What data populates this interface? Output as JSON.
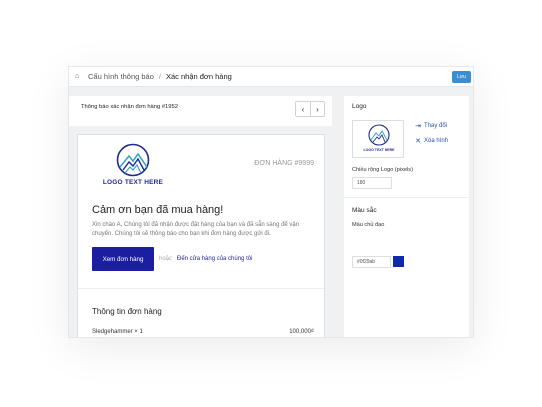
{
  "breadcrumb": {
    "parent": "Cấu hình thông báo",
    "separator": "/",
    "current": "Xác nhận đơn hàng"
  },
  "toolbar": {
    "save_label": "Lưu"
  },
  "preview": {
    "header_title": "Thông báo xác nhận đơn hàng #1952",
    "prev_icon": "chevron-left-icon",
    "next_icon": "chevron-right-icon"
  },
  "email": {
    "logo_text": "LOGO TEXT HERE",
    "order_number": "ĐƠN HÀNG #9999",
    "thanks_title": "Cảm ơn bạn đã mua hàng!",
    "thanks_desc": "Xin chào A, Chúng tôi đã nhận được đặt hàng của bạn và đã sẵn sàng để vận chuyển. Chúng tôi sẽ thông báo cho bạn khi đơn hàng được gửi đi.",
    "view_order_label": "Xem đơn hàng",
    "or_label": "hoặc",
    "shop_link_label": "Đến cửa hàng của chúng tôi",
    "order_info_title": "Thông tin đơn hàng",
    "items": [
      {
        "name": "Sledgehammer × 1",
        "price": "100,000₫"
      }
    ]
  },
  "settings": {
    "logo_title": "Logo",
    "logo_text": "LOGO TEXT HERE",
    "change_label": "Thay đổi",
    "delete_label": "Xóa hình",
    "logo_width_label": "Chiều rộng Logo (pixels)",
    "logo_width_value": "180",
    "color_title": "Màu sắc",
    "main_color_label": "Màu chủ đạo",
    "main_color_value": "#0f29ab"
  },
  "colors": {
    "accent": "#0f29ab",
    "save_button": "#3b8fd0",
    "button_primary": "#1c1ea2"
  }
}
